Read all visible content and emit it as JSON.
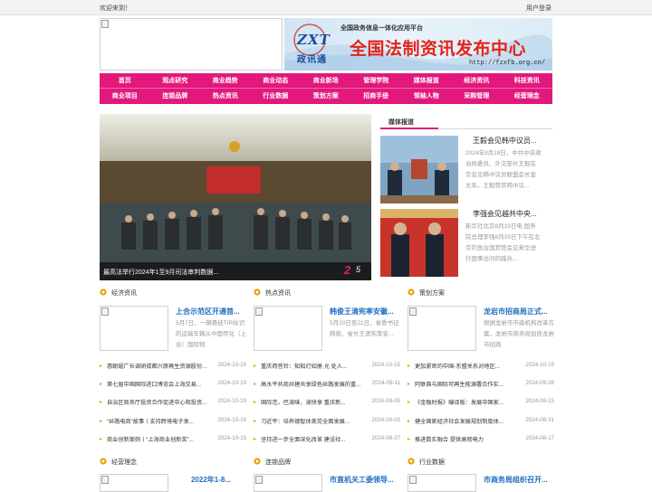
{
  "topbar": {
    "welcome": "欢迎来到！",
    "login": "用户登录"
  },
  "banner": {
    "tagline": "全国政务信息一体化应用平台",
    "brand_latin": "ZXT",
    "brand_cn": "政讯通",
    "headline": "全国法制资讯发布中心",
    "url": "http://fzxfb.org.cn/"
  },
  "nav": {
    "row1": [
      "首页",
      "观点研究",
      "商业趋势",
      "商业动态",
      "商业新场",
      "管理学院",
      "媒体报道",
      "经济资讯",
      "科技资讯"
    ],
    "row2": [
      "商业项目",
      "连锁品牌",
      "热点资讯",
      "行业数据",
      "策划方案",
      "招商手册",
      "领袖人物",
      "采购管理",
      "经营理念"
    ]
  },
  "slider": {
    "caption": "最高法举行2024年1至9月司法审判数据...",
    "current": "2",
    "total": "5"
  },
  "media": {
    "title": "媒体报道",
    "cards": [
      {
        "title": "王毅会见韩中议员...",
        "desc": "2024年9月18日，中共中央政治局委员、外交部长王毅在京会见韩中议员联盟会长金太年。王毅赞赏韩中议..."
      },
      {
        "title": "李强会见越共中央...",
        "desc": "新华社北京8月19日电 国务院总理李强8月19日下午在北京钓鱼台国宾馆会见来华进行国事访问的越共..."
      }
    ]
  },
  "sections": [
    {
      "title": "经济资讯",
      "lead_title": "上合示范区开通首...",
      "lead_desc": "5月7日，一辆悬挂TIR标识的运输车辆从中国传化（上合）国际物",
      "news": [
        {
          "text": "惠朝堀广长调研成都兴原再生资源股份...",
          "date": "2024-10-19"
        },
        {
          "text": "第七届中国国际进口博览会上海交易...",
          "date": "2024-10-19"
        },
        {
          "text": "自治区商务厅投资合作促进中心和投资...",
          "date": "2024-10-19"
        },
        {
          "text": "“丝路电商”故事丨支持跨境电子发...",
          "date": "2024-10-19"
        },
        {
          "text": "商业创新案例丨“上海商业创新奖”...",
          "date": "2024-10-19"
        }
      ]
    },
    {
      "title": "热点资讯",
      "lead_title": "韩俊王清宪率安徽...",
      "lead_desc": "5月20日至21日，省委书记韩俊、省长王清宪率安...",
      "news": [
        {
          "text": "重庆荷音铃：知知灯如册 允 处人...",
          "date": "2024-10-15"
        },
        {
          "text": "高水平共商共建共享绿色丝路发展的重...",
          "date": "2024-09-11"
        },
        {
          "text": "国际范，巴渝味，渝快享 重庆新...",
          "date": "2024-09-05"
        },
        {
          "text": "习近平：培养德智体美劳全面发展...",
          "date": "2024-09-03"
        },
        {
          "text": "坚持进一步全面深化改革 建设社...",
          "date": "2024-08-27"
        }
      ]
    },
    {
      "title": "策划方案",
      "lead_title": "龙岩市招商局正式...",
      "lead_desc": "根据龙岩市市级机构改革方案，龙岩市商务局加挂龙岩市招商",
      "news": [
        {
          "text": "更加紧密的中国-东盟关系对地区...",
          "date": "2024-10-15"
        },
        {
          "text": "阿联酋与国际可再生能源署合作实...",
          "date": "2024-09-28"
        },
        {
          "text": "《金融时报》编译版：发展中国家...",
          "date": "2024-09-15"
        },
        {
          "text": "健全国家经济社会发展规划制度体...",
          "date": "2024-08-31"
        },
        {
          "text": "推进数实融合 提供高韧电力",
          "date": "2024-08-17"
        }
      ]
    }
  ],
  "bottom_sections": [
    {
      "title": "经营理念",
      "lead_title": "2022年1-8..."
    },
    {
      "title": "连锁品牌",
      "lead_title": "市直机关工委领导..."
    },
    {
      "title": "行业数据",
      "lead_title": "市商务局组织召开..."
    }
  ],
  "colors": {
    "accent": "#e2187d",
    "link": "#1e6fbf",
    "icon": "#e8a000"
  }
}
